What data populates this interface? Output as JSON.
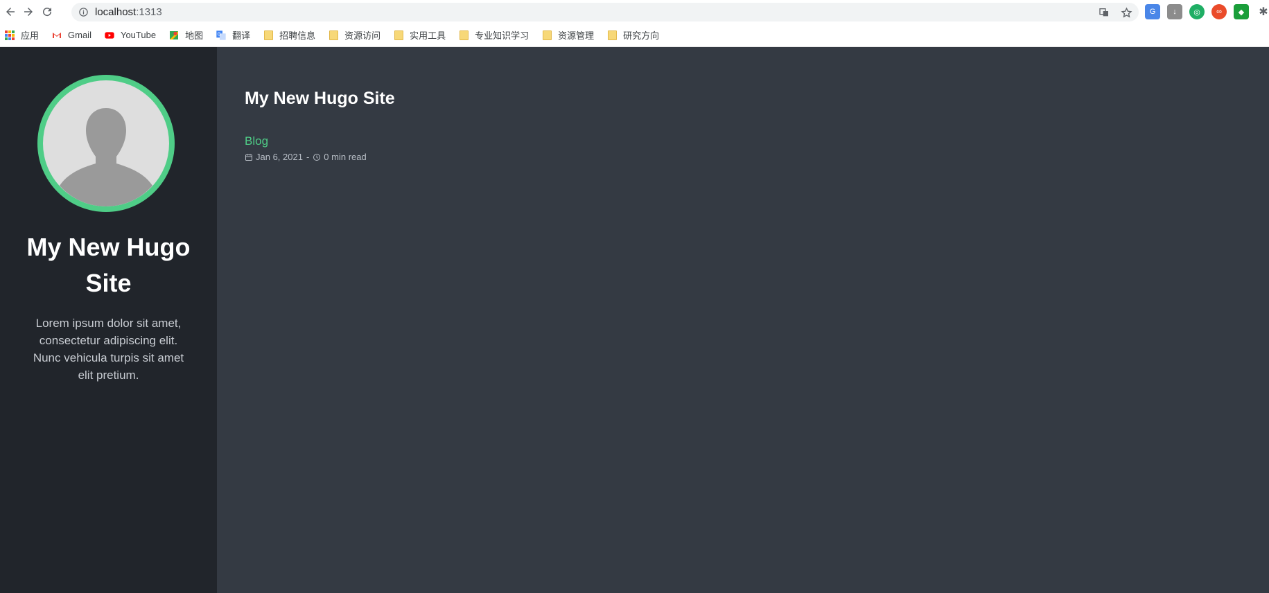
{
  "browser": {
    "url_host": "localhost",
    "url_port": ":1313"
  },
  "bookmarks": [
    {
      "label": "应用",
      "icon": "apps-grid-icon"
    },
    {
      "label": "Gmail",
      "icon": "gmail-icon"
    },
    {
      "label": "YouTube",
      "icon": "youtube-icon"
    },
    {
      "label": "地图",
      "icon": "maps-icon"
    },
    {
      "label": "翻译",
      "icon": "translate-icon"
    },
    {
      "label": "招聘信息",
      "icon": "folder-icon"
    },
    {
      "label": "资源访问",
      "icon": "folder-icon"
    },
    {
      "label": "实用工具",
      "icon": "folder-icon"
    },
    {
      "label": "专业知识学习",
      "icon": "folder-icon"
    },
    {
      "label": "资源管理",
      "icon": "folder-icon"
    },
    {
      "label": "研究方向",
      "icon": "folder-icon"
    }
  ],
  "sidebar": {
    "title": "My New Hugo Site",
    "description": "Lorem ipsum dolor sit amet, consectetur adipiscing elit. Nunc vehicula turpis sit amet elit pretium."
  },
  "main": {
    "title": "My New Hugo Site",
    "posts": [
      {
        "title": "Blog",
        "date": "Jan 6, 2021",
        "separator": "-",
        "read_time": "0 min read"
      }
    ]
  },
  "colors": {
    "accent": "#4fcd87",
    "sidebar_bg": "#21252b",
    "main_bg": "#343a43"
  }
}
